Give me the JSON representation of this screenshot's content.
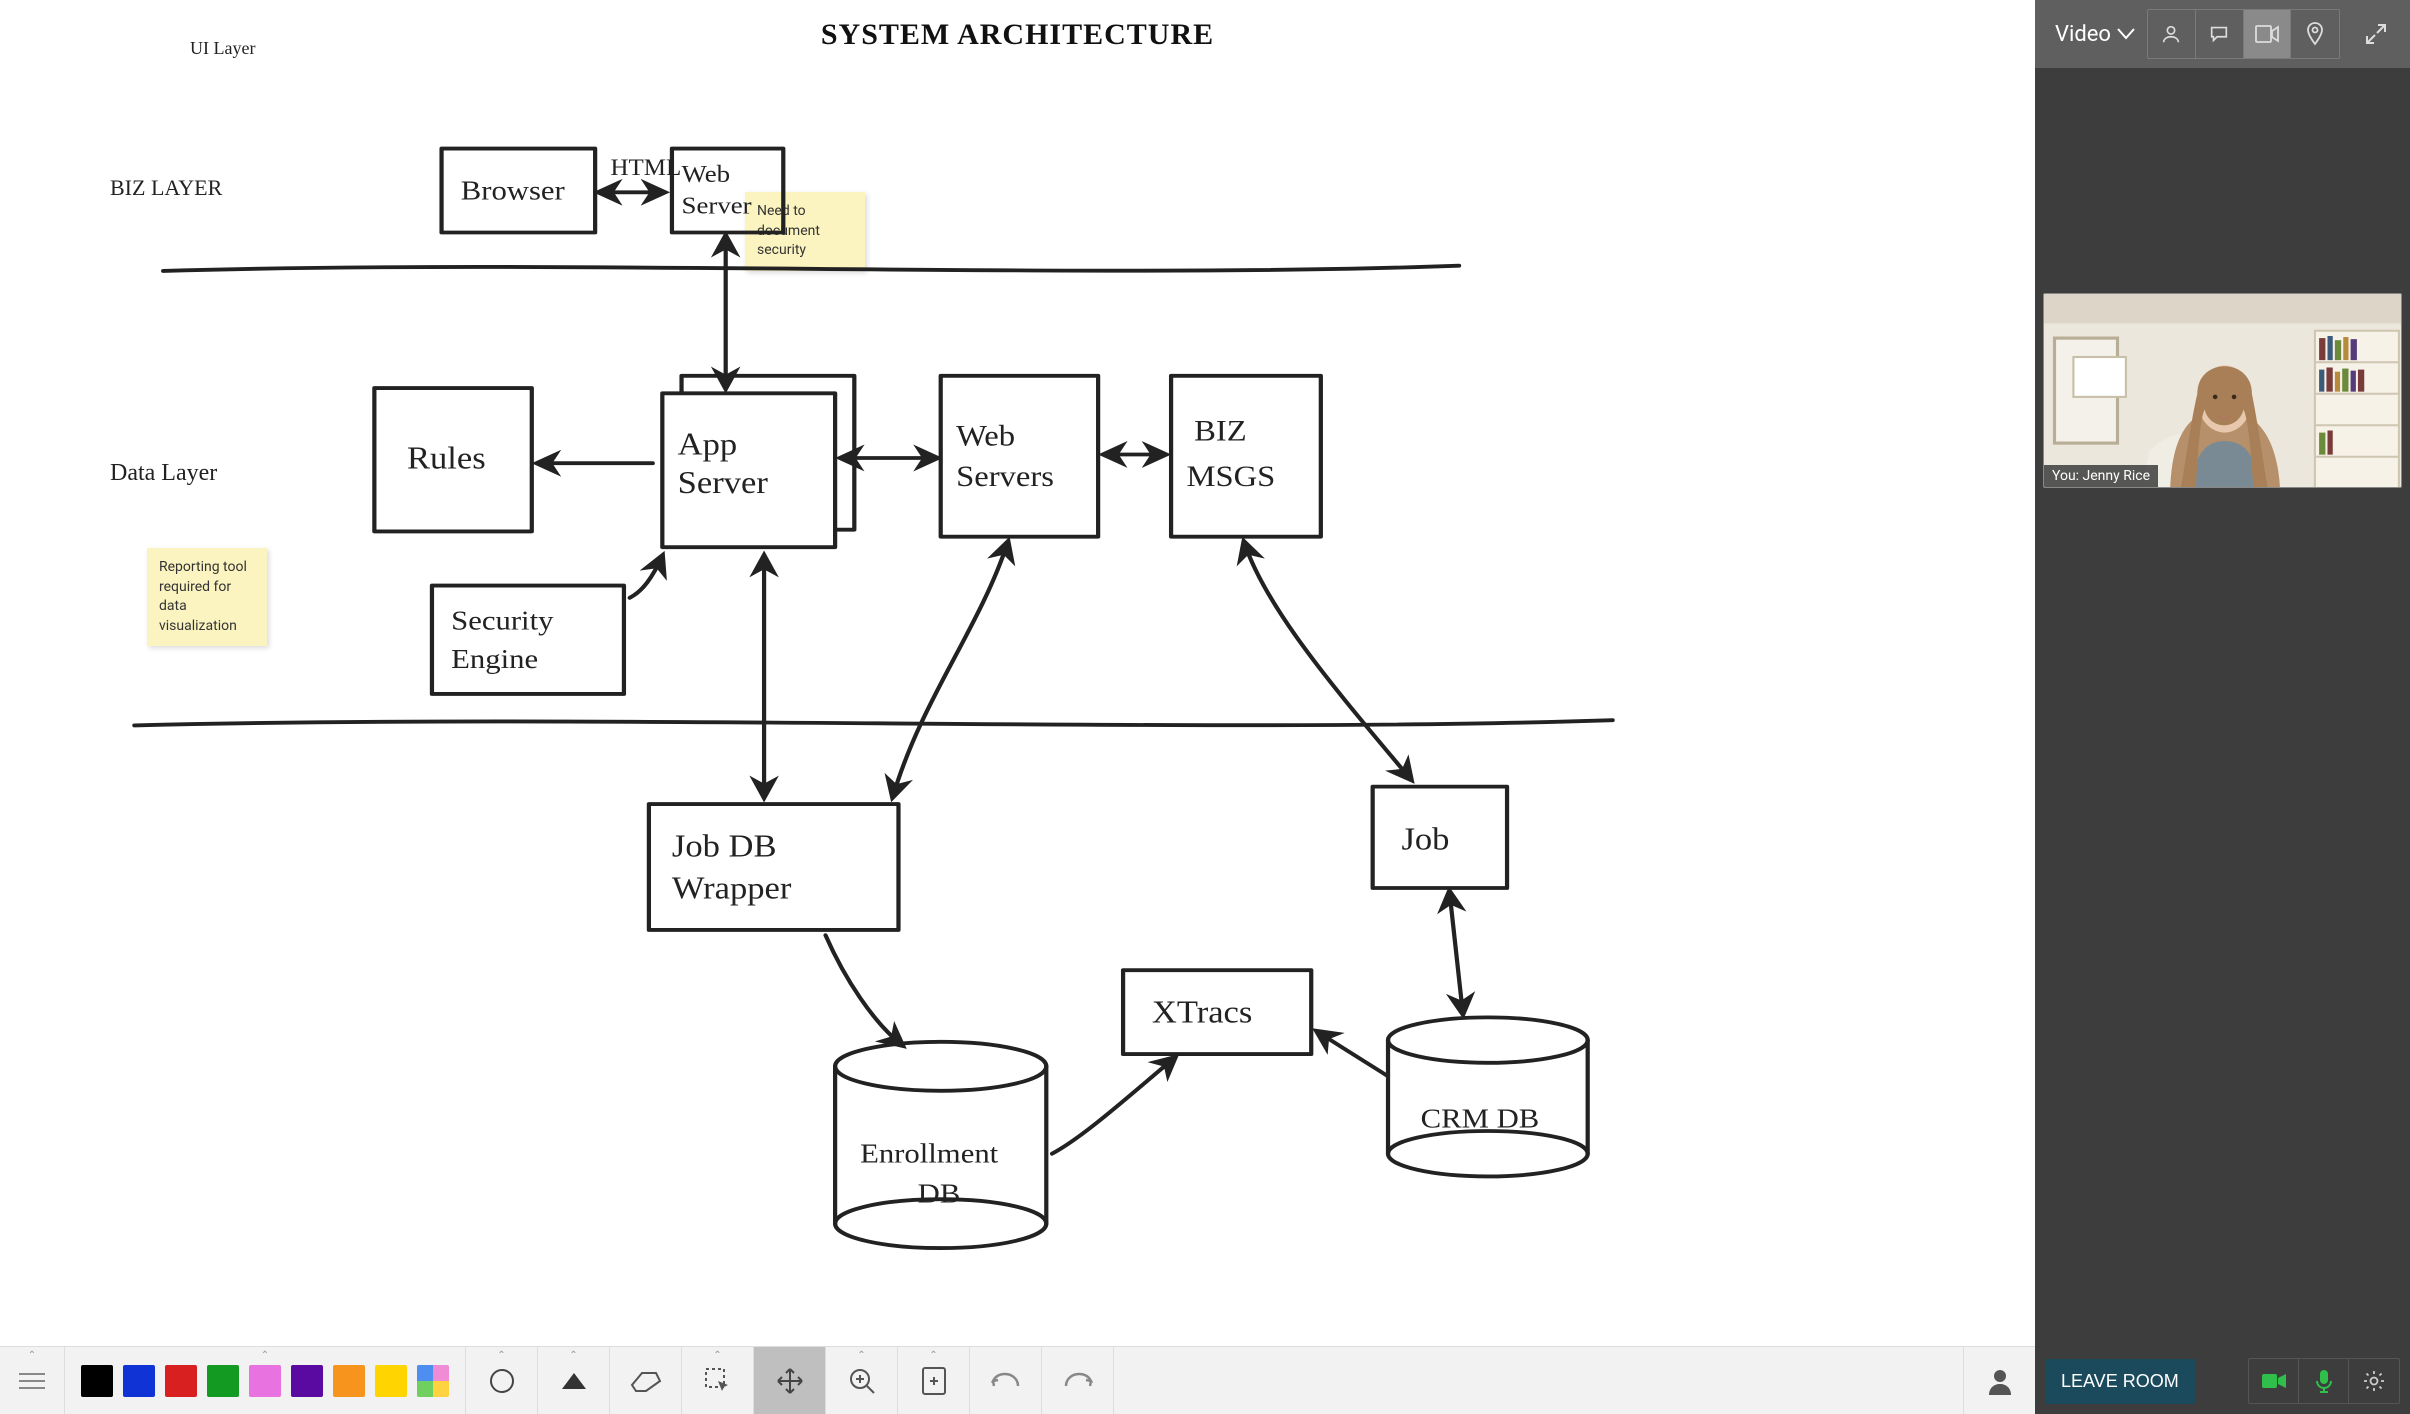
{
  "canvas": {
    "title": "SYSTEM ARCHITECTURE",
    "layers": {
      "ui": "UI Layer",
      "biz": "BIZ LAYER",
      "data": "Data Layer"
    },
    "boxes": {
      "browser": "Browser",
      "html": "HTML",
      "web_server": "Web Server",
      "rules": "Rules",
      "app_server": "App Server",
      "web_servers": "Web Servers",
      "biz_msgs": "BIZ MSGS",
      "security_engine": "Security Engine",
      "job_db_wrapper": "Job DB Wrapper",
      "job": "Job",
      "xtracs": "XTracs",
      "enrollment_db": "Enrollment DB",
      "crm_db": "CRM DB"
    },
    "stickies": {
      "security": "Need to document security",
      "reporting": "Reporting tool required for data visualization"
    }
  },
  "video_panel": {
    "dropdown_label": "Video",
    "participant_label": "You: Jenny Rice",
    "leave_label": "LEAVE ROOM"
  },
  "toolbar": {
    "colors": [
      "#000000",
      "#1033d6",
      "#d92020",
      "#139a22",
      "#e873e0",
      "#5a0aa0",
      "#f7941d",
      "#ffd400"
    ]
  }
}
